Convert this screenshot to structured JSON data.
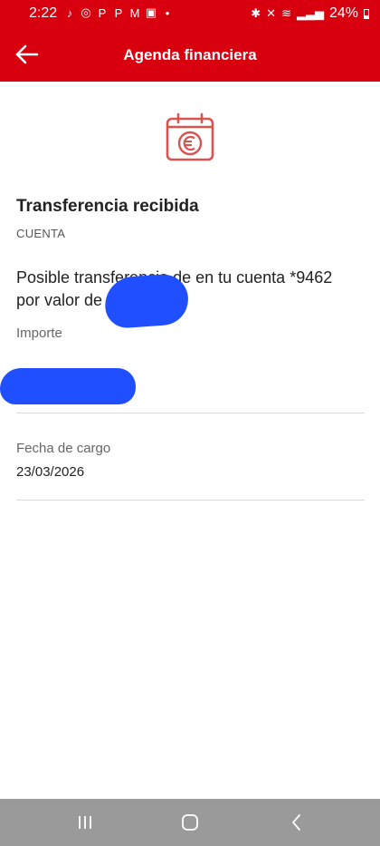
{
  "status_bar": {
    "time": "2:22",
    "battery": "24%",
    "left_icons": [
      "tiktok-icon",
      "whatsapp-icon",
      "paypal-icon",
      "paypal-icon",
      "gmail-icon",
      "gallery-icon",
      "dot-icon"
    ],
    "right_icons": [
      "bluetooth-icon",
      "mute-icon",
      "wifi-icon",
      "signal-icon",
      "battery-icon"
    ]
  },
  "app_bar": {
    "title": "Agenda financiera",
    "back_icon": "arrow-left-icon"
  },
  "detail": {
    "icon": "calendar-euro-icon",
    "title": "Transferencia recibida",
    "account_label": "CUENTA",
    "description": "Posible transferencia de  en tu cuenta *9462 por valor de",
    "amount_label": "Importe",
    "date_label": "Fecha de cargo",
    "date_value": "23/03/2026"
  },
  "nav_bar": {
    "recents_icon": "recents-icon",
    "home_icon": "home-icon",
    "back_icon": "back-chevron-icon"
  },
  "colors": {
    "brand_red": "#d8000f",
    "icon_red": "#d9534f",
    "redaction_blue": "#1f4fff",
    "nav_gray": "#9a9a9a"
  }
}
